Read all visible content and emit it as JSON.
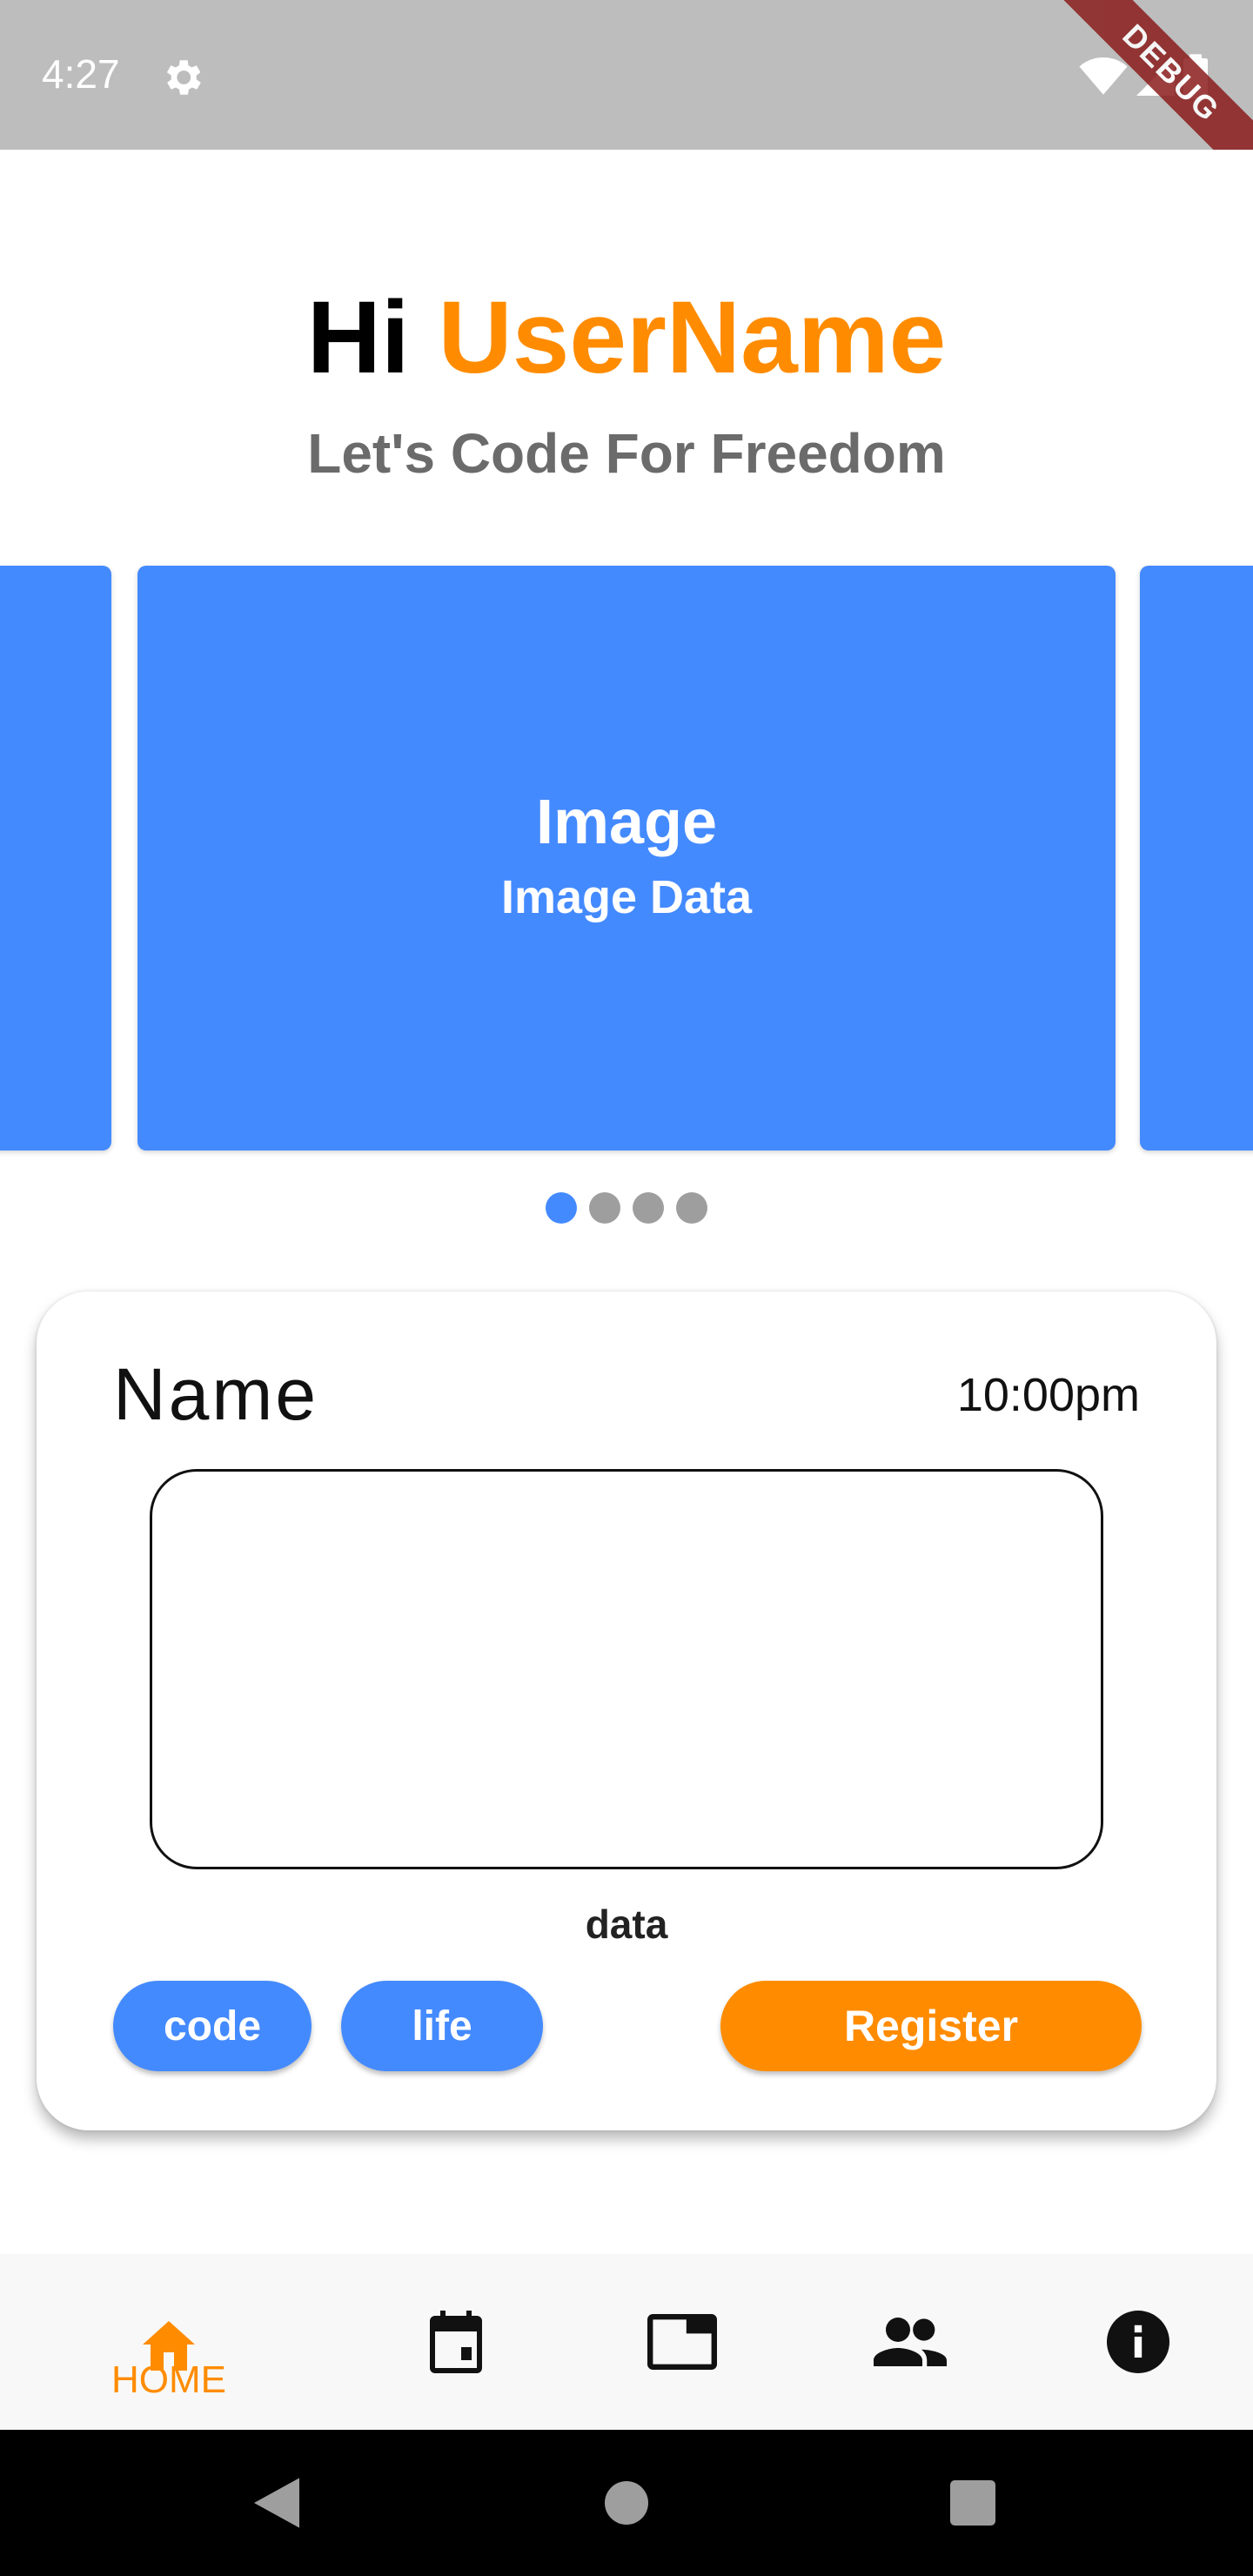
{
  "status_bar": {
    "time": "4:27",
    "debug_label": "DEBUG"
  },
  "header": {
    "greeting_prefix": "Hi ",
    "username": "UserName",
    "subtitle": "Let's Code For Freedom"
  },
  "carousel": {
    "title": "Image",
    "subtitle": "Image Data",
    "page_count": 4,
    "active_index": 0
  },
  "card": {
    "name": "Name",
    "time": "10:00pm",
    "data_label": "data",
    "tags": [
      "code",
      "life"
    ],
    "register_label": "Register"
  },
  "bottom_nav": {
    "items": [
      {
        "icon": "home-icon",
        "label": "HOME",
        "active": true
      },
      {
        "icon": "calendar-icon",
        "label": ""
      },
      {
        "icon": "picture-in-picture-icon",
        "label": ""
      },
      {
        "icon": "people-icon",
        "label": ""
      },
      {
        "icon": "info-icon",
        "label": ""
      }
    ]
  },
  "colors": {
    "accent_orange": "#ff8c00",
    "accent_blue": "#448aff",
    "status_bar": "#bdbdbd",
    "dot_inactive": "#9e9e9e"
  }
}
